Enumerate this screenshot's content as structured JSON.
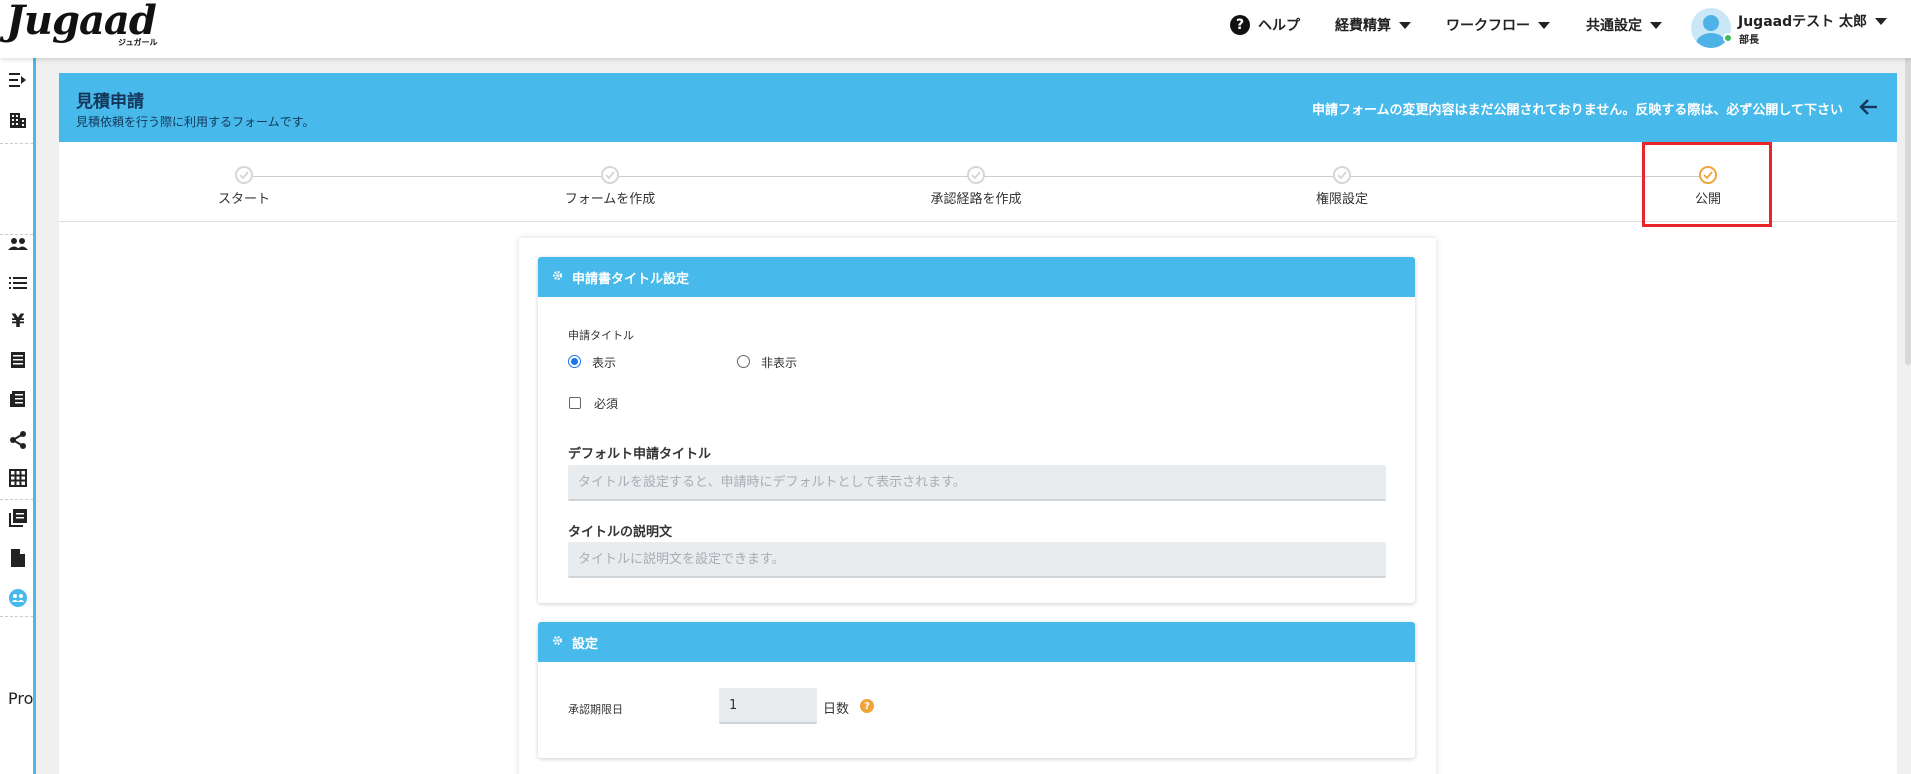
{
  "header": {
    "logo": "Jugaad",
    "logo_sub": "ジュガール",
    "nav": {
      "help": "ヘルプ",
      "expense": "経費精算",
      "workflow": "ワークフロー",
      "common": "共通設定"
    },
    "user": {
      "name": "Jugaadテスト 太郎",
      "role": "部長"
    }
  },
  "sidebar": {
    "footer_text": "Pro"
  },
  "page": {
    "title": "見積申請",
    "subtitle": "見積依頼を行う際に利用するフォームです。",
    "notice": "申請フォームの変更内容はまだ公開されておりません。反映する際は、必ず公開して下さい"
  },
  "steps": [
    {
      "label": "スタート",
      "state": "done"
    },
    {
      "label": "フォームを作成",
      "state": "done"
    },
    {
      "label": "承認経路を作成",
      "state": "done"
    },
    {
      "label": "権限設定",
      "state": "done"
    },
    {
      "label": "公開",
      "state": "active"
    }
  ],
  "title_card": {
    "heading": "申請書タイトル設定",
    "title_label": "申請タイトル",
    "show_option": "表示",
    "hide_option": "非表示",
    "selected": "表示",
    "required_label": "必須",
    "required_checked": false,
    "default_title_label": "デフォルト申請タイトル",
    "default_title_placeholder": "タイトルを設定すると、申請時にデフォルトとして表示されます。",
    "description_label": "タイトルの説明文",
    "description_placeholder": "タイトルに説明文を設定できます。"
  },
  "settings_card": {
    "heading": "設定",
    "deadline_label": "承認期限日",
    "deadline_value": "1",
    "deadline_unit": "日数"
  },
  "colors": {
    "accent": "#47b9ea",
    "active_step": "#f0a43a",
    "highlight": "#e8262a"
  }
}
